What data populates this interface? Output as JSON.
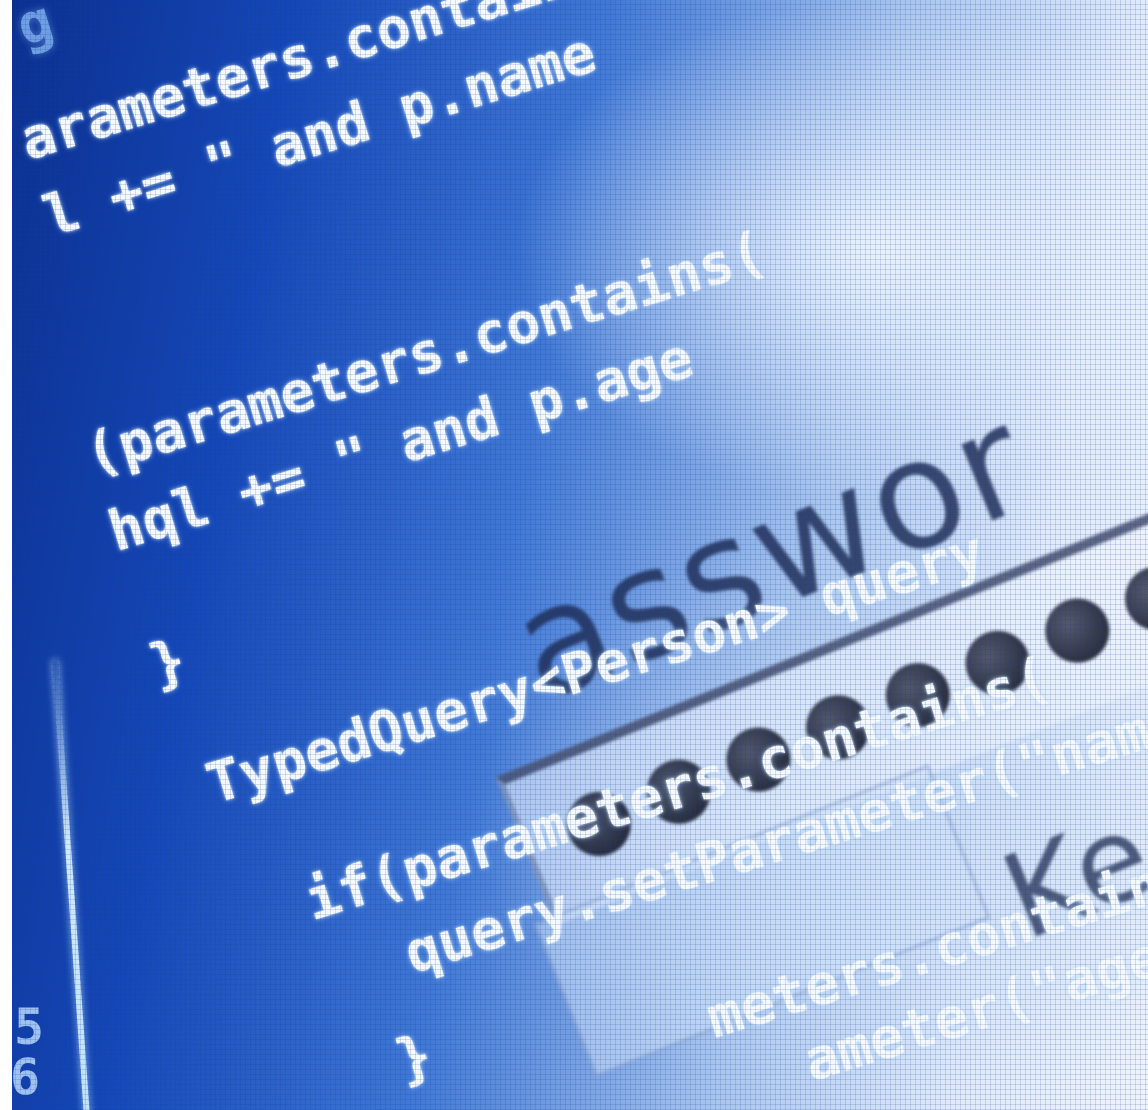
{
  "scene": {
    "description_colors": {
      "deep_blue": "#0a2f8f",
      "mid_blue": "#3f78d6",
      "light_blue": "#dfeafb",
      "code_text": "#f4f9ff",
      "code_dim": "#8fc3ff",
      "password_text": "#1f2e57"
    }
  },
  "code": {
    "lines": [
      "g ",
      "arameters.contains",
      "l += \" and p.name",
      "(parameters.contains(",
      "hql += \" and p.age",
      "}",
      "TypedQuery<Person> query",
      "if(parameters.contains(",
      "query.setParameter(\"name",
      "}",
      "meters.contains(",
      "ameter(\"age\""
    ],
    "line_numbers": [
      "5",
      "6"
    ]
  },
  "login": {
    "password_label": "asswor",
    "mask_dots_count": 8,
    "keep_label": "Kee"
  }
}
